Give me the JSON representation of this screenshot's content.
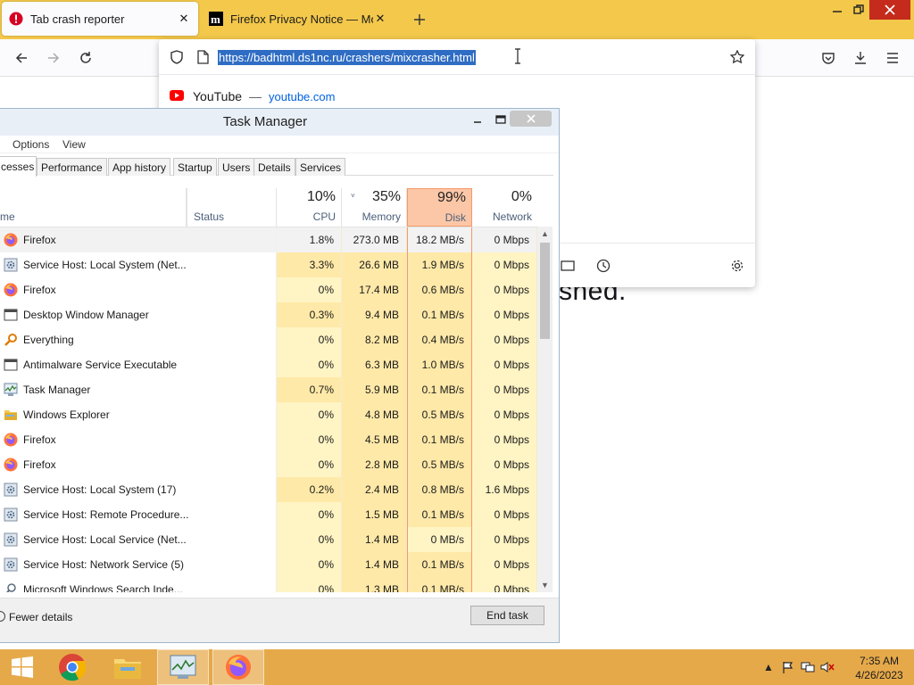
{
  "browser": {
    "tabs": [
      {
        "title": "Tab crash reporter",
        "icon": "crash-warning-icon",
        "active": true
      },
      {
        "title": "Firefox Privacy Notice — Mozilla",
        "icon": "mozilla-m-icon",
        "active": false
      }
    ],
    "close_glyph": "✕",
    "newtab_glyph": "+",
    "url": "https://badhtml.ds1nc.ru/crashers/mixcrasher.html",
    "suggestion": {
      "title": "YouTube",
      "separator": "—",
      "url": "youtube.com"
    },
    "page_fragment": "shed.",
    "accent": "#f3c84b"
  },
  "taskmgr": {
    "title": "Task Manager",
    "menu": [
      "Options",
      "View"
    ],
    "tabs": [
      "cesses",
      "Performance",
      "App history",
      "Startup",
      "Users",
      "Details",
      "Services"
    ],
    "columns": {
      "name": "me",
      "status": "Status",
      "cpu": {
        "pct": "10%",
        "label": "CPU"
      },
      "memory": {
        "pct": "35%",
        "label": "Memory"
      },
      "disk": {
        "pct": "99%",
        "label": "Disk"
      },
      "network": {
        "pct": "0%",
        "label": "Network"
      }
    },
    "rows": [
      {
        "name": "Firefox",
        "icon": "firefox-icon",
        "cpu": "1.8%",
        "mem": "273.0 MB",
        "disk": "18.2 MB/s",
        "net": "0 Mbps"
      },
      {
        "name": "Service Host: Local System (Net...",
        "icon": "gear-icon",
        "cpu": "3.3%",
        "mem": "26.6 MB",
        "disk": "1.9 MB/s",
        "net": "0 Mbps"
      },
      {
        "name": "Firefox",
        "icon": "firefox-icon",
        "cpu": "0%",
        "mem": "17.4 MB",
        "disk": "0.6 MB/s",
        "net": "0 Mbps"
      },
      {
        "name": "Desktop Window Manager",
        "icon": "window-icon",
        "cpu": "0.3%",
        "mem": "9.4 MB",
        "disk": "0.1 MB/s",
        "net": "0 Mbps"
      },
      {
        "name": "Everything",
        "icon": "magnifier-icon",
        "cpu": "0%",
        "mem": "8.2 MB",
        "disk": "0.4 MB/s",
        "net": "0 Mbps"
      },
      {
        "name": "Antimalware Service Executable",
        "icon": "window-icon",
        "cpu": "0%",
        "mem": "6.3 MB",
        "disk": "1.0 MB/s",
        "net": "0 Mbps"
      },
      {
        "name": "Task Manager",
        "icon": "taskmgr-icon",
        "cpu": "0.7%",
        "mem": "5.9 MB",
        "disk": "0.1 MB/s",
        "net": "0 Mbps"
      },
      {
        "name": "Windows Explorer",
        "icon": "folder-icon",
        "cpu": "0%",
        "mem": "4.8 MB",
        "disk": "0.5 MB/s",
        "net": "0 Mbps"
      },
      {
        "name": "Firefox",
        "icon": "firefox-icon",
        "cpu": "0%",
        "mem": "4.5 MB",
        "disk": "0.1 MB/s",
        "net": "0 Mbps"
      },
      {
        "name": "Firefox",
        "icon": "firefox-icon",
        "cpu": "0%",
        "mem": "2.8 MB",
        "disk": "0.5 MB/s",
        "net": "0 Mbps"
      },
      {
        "name": "Service Host: Local System (17)",
        "icon": "gear-icon",
        "cpu": "0.2%",
        "mem": "2.4 MB",
        "disk": "0.8 MB/s",
        "net": "1.6 Mbps"
      },
      {
        "name": "Service Host: Remote Procedure...",
        "icon": "gear-icon",
        "cpu": "0%",
        "mem": "1.5 MB",
        "disk": "0.1 MB/s",
        "net": "0 Mbps"
      },
      {
        "name": "Service Host: Local Service (Net...",
        "icon": "gear-icon",
        "cpu": "0%",
        "mem": "1.4 MB",
        "disk": "0 MB/s",
        "net": "0 Mbps"
      },
      {
        "name": "Service Host: Network Service (5)",
        "icon": "gear-icon",
        "cpu": "0%",
        "mem": "1.4 MB",
        "disk": "0.1 MB/s",
        "net": "0 Mbps"
      },
      {
        "name": "Microsoft Windows Search Inde...",
        "icon": "search-person-icon",
        "cpu": "0%",
        "mem": "1.3 MB",
        "disk": "0.1 MB/s",
        "net": "0 Mbps"
      }
    ],
    "fewer_details": "Fewer details",
    "end_task": "End task",
    "colors": {
      "cell_light": "#fff4c4",
      "cell_mid": "#ffe9a8",
      "disk_header": "#fcc7a7"
    }
  },
  "taskbar": {
    "apps": [
      "chrome-icon",
      "file-explorer-icon",
      "task-manager-icon",
      "firefox-icon"
    ],
    "time": "7:35 AM",
    "date": "4/26/2023",
    "color": "#e6a94a"
  }
}
